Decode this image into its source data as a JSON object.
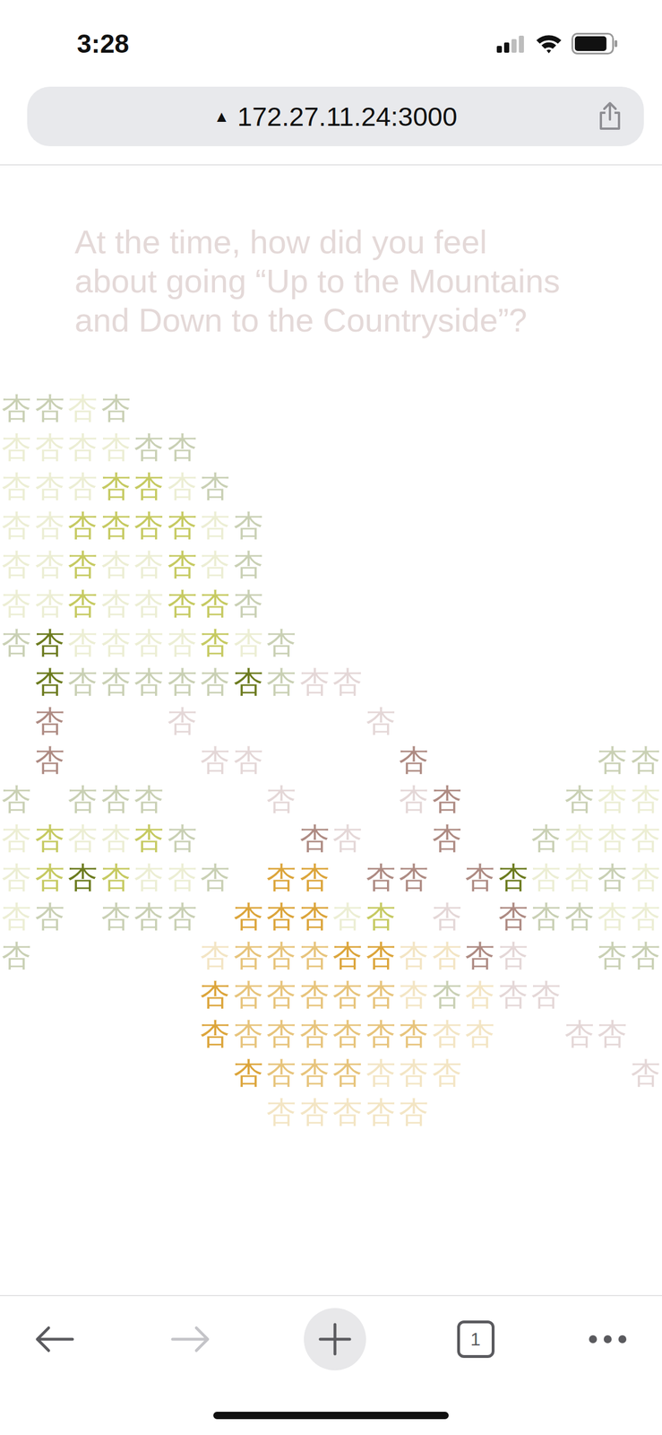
{
  "status_bar": {
    "time": "3:28",
    "signal": {
      "level": 0.5
    },
    "battery": {
      "level": 0.9
    }
  },
  "address_bar": {
    "warning_icon": "▲",
    "url": "172.27.11.24:3000"
  },
  "question": "At the time, how did you feel about going “Up to the Mountains and Down to the Countryside”?",
  "grid": {
    "glyph": "杏",
    "palette": {
      "s": "#c9d0b4",
      "v": "#eceed4",
      "y": "#c6ca62",
      "o": "#6c7b1f",
      "p": "#e4d7d7",
      "m": "#ae8b83",
      "g": "#dca53b",
      "t": "#e7c47c",
      "c": "#f3e5c4"
    },
    "rows": [
      "ssvs                ",
      "vvvvss              ",
      "vvvyyvs             ",
      "vvyyyyvs            ",
      "vvyvvyvs            ",
      "vvyvvyys            ",
      "sovvvvyvs           ",
      " osssssospp         ",
      " m   p     p        ",
      " m    pp    m     ss",
      "s sss   p   pm   svv",
      "vyvvys   mp  m  svvv",
      "vyoyvvs gg mm movvsv",
      "vs sss gggvy p mssvv",
      "s     ctttggccmp  ss",
      "      gtttttcscpp   ",
      "      gttttttcc  pp ",
      "       gtttccc     p",
      "        ccccc       "
    ]
  },
  "toolbar": {
    "back_enabled": true,
    "forward_enabled": false,
    "tab_count": "1"
  }
}
